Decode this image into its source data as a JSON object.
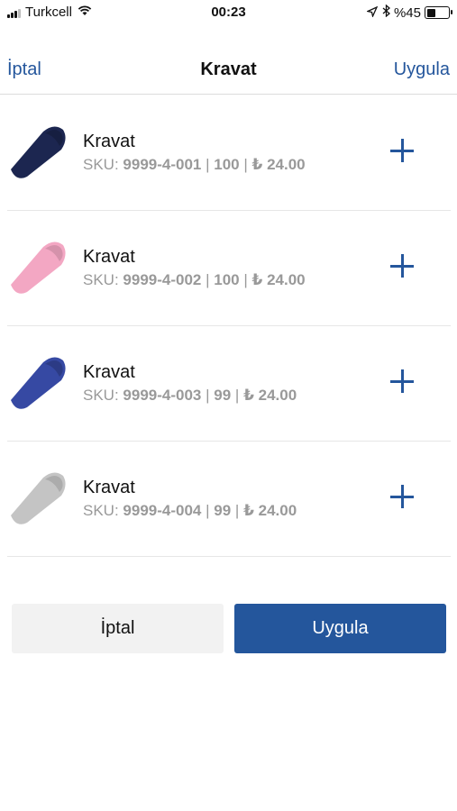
{
  "status_bar": {
    "carrier": "Turkcell",
    "time": "00:23",
    "battery": "%45",
    "battery_level": 0.45,
    "icons": [
      "signal-icon",
      "wifi-icon",
      "location-icon",
      "bluetooth-icon",
      "battery-icon"
    ]
  },
  "nav": {
    "cancel_label": "İptal",
    "title": "Kravat",
    "apply_label": "Uygula"
  },
  "products": [
    {
      "name": "Kravat",
      "sku_label": "SKU:",
      "sku": "9999-4-001",
      "stock": "100",
      "price": "₺ 24.00",
      "color": "#1c2650"
    },
    {
      "name": "Kravat",
      "sku_label": "SKU:",
      "sku": "9999-4-002",
      "stock": "100",
      "price": "₺ 24.00",
      "color": "#f3a7c3"
    },
    {
      "name": "Kravat",
      "sku_label": "SKU:",
      "sku": "9999-4-003",
      "stock": "99",
      "price": "₺ 24.00",
      "color": "#3649a3"
    },
    {
      "name": "Kravat",
      "sku_label": "SKU:",
      "sku": "9999-4-004",
      "stock": "99",
      "price": "₺ 24.00",
      "color": "#c4c4c4"
    }
  ],
  "footer": {
    "cancel_label": "İptal",
    "apply_label": "Uygula"
  },
  "colors": {
    "accent": "#24569c",
    "muted_text": "#999999",
    "cancel_bg": "#f2f2f2"
  }
}
